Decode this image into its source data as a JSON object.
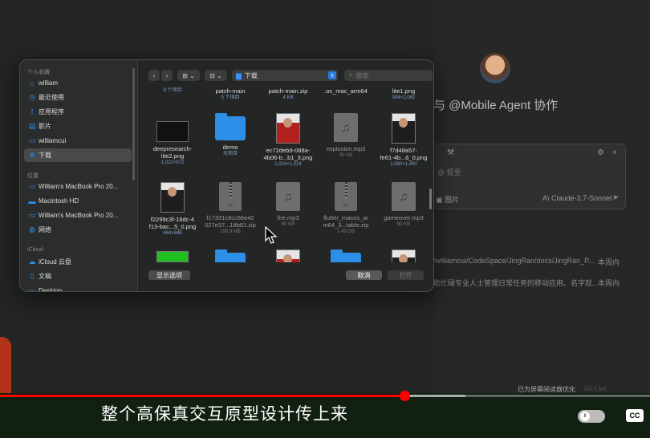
{
  "background": {
    "title": "与 @Mobile Agent 协作",
    "chat_placeholder": "@ 提至",
    "image_label": "▣ 图片",
    "model_label": "A\\ Claude-3.7-Sonnet",
    "rows": [
      {
        "text": "/williamcui/CodeSpace/JingRan/docs/JingRan_P...",
        "time": "本周内"
      },
      {
        "text": "助忙碌专业人士管理日常任务的移动应用。名字就...",
        "time": "本周内"
      }
    ],
    "footer_left": "已为屏幕阅读器优化",
    "footer_right": "Go Live"
  },
  "sidebar": {
    "favorites_title": "个人收藏",
    "favorites": [
      {
        "label": "william",
        "icon": "⌂",
        "icon_name": "home-icon"
      },
      {
        "label": "最近使用",
        "icon": "◷",
        "icon_name": "clock-icon"
      },
      {
        "label": "应用程序",
        "icon": "⟟",
        "icon_name": "applications-icon"
      },
      {
        "label": "影片",
        "icon": "▤",
        "icon_name": "movies-icon"
      },
      {
        "label": "williamcui",
        "icon": "▭",
        "icon_name": "folder-icon"
      },
      {
        "label": "下载",
        "icon": "⊕",
        "icon_name": "downloads-icon"
      }
    ],
    "locations_title": "位置",
    "locations": [
      {
        "label": "William's MacBook Pro 20...",
        "icon": "▭",
        "icon_name": "laptop-icon"
      },
      {
        "label": "Macintosh HD",
        "icon": "▬",
        "icon_name": "disk-icon"
      },
      {
        "label": "William's MacBook Pro 20...",
        "icon": "▭",
        "icon_name": "laptop-icon"
      },
      {
        "label": "网络",
        "icon": "◍",
        "icon_name": "network-icon"
      }
    ],
    "icloud_title": "iCloud",
    "icloud": [
      {
        "label": "iCloud 云盘",
        "icon": "☁",
        "icon_name": "cloud-icon"
      },
      {
        "label": "文稿",
        "icon": "▯",
        "icon_name": "document-icon"
      },
      {
        "label": "Desktop",
        "icon": "▭",
        "icon_name": "folder-icon"
      }
    ]
  },
  "toolbar": {
    "back": "‹",
    "forward": "›",
    "view_grid": "⊞ ⌄",
    "group": "⊟ ⌄",
    "location": "下载",
    "location_arrow": "⇕",
    "search_placeholder": "搜索"
  },
  "top_row": [
    {
      "name": "",
      "meta": "9 个项目"
    },
    {
      "name": "patch-main",
      "meta": "5 个项目"
    },
    {
      "name": "patch-main.zip",
      "meta": "4 KB"
    },
    {
      "name": ".os_mac_arm64",
      "meta": ""
    },
    {
      "name": "lite1.png",
      "meta": "904×1,062"
    }
  ],
  "files": [
    {
      "name1": "deepresearch-",
      "name2": "lite2.png",
      "meta": "1,022×872",
      "kind": "png",
      "dim": false
    },
    {
      "name1": "demo",
      "name2": "",
      "meta": "无项目",
      "kind": "folder",
      "dim": false
    },
    {
      "name1": "ec72deb9-088a-",
      "name2": "4b06-b...b1_3.png",
      "meta": "1,024×1,024",
      "kind": "portrait-red",
      "dim": false
    },
    {
      "name1": "explosion.mp3",
      "name2": "",
      "meta": "90 KB",
      "kind": "audio",
      "dim": true
    },
    {
      "name1": "f7d48a57-",
      "name2": "fe61-4b...6_0.png",
      "meta": "1,080×1,440",
      "kind": "portrait",
      "dim": false
    },
    {
      "name1": "f2299c3f-16dc-4",
      "name2": "f13-bac...5_0.png",
      "meta": "464×848",
      "kind": "portrait",
      "dim": false
    },
    {
      "name1": "f17331c8cc66e42",
      "name2": "027e37...18b81.zip",
      "meta": "199.9 MB",
      "kind": "zip",
      "dim": true
    },
    {
      "name1": "fire.mp3",
      "name2": "",
      "meta": "90 KB",
      "kind": "audio",
      "dim": true
    },
    {
      "name1": "flutter_macos_ar",
      "name2": "m64_3...table.zip",
      "meta": "1.49 GB",
      "kind": "zip",
      "dim": true
    },
    {
      "name1": "gameover.mp3",
      "name2": "",
      "meta": "90 KB",
      "kind": "audio",
      "dim": true
    }
  ],
  "buttons": {
    "options": "显示选项",
    "cancel": "取消",
    "open": "打开"
  },
  "player": {
    "subtitle": "整个高保真交互原型设计传上来",
    "progress": 0.622,
    "buffered": 0.716,
    "pause_glyph": "II",
    "cc": "CC"
  }
}
